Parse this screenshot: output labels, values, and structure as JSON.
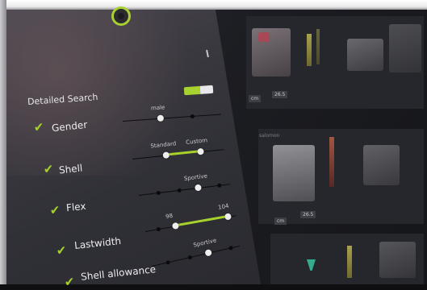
{
  "panel": {
    "title": "Detailed Search",
    "toggle_on": true,
    "filters": [
      {
        "id": "gender",
        "label": "Gender",
        "checked": true,
        "labels": [
          "male"
        ]
      },
      {
        "id": "shell",
        "label": "Shell",
        "checked": true,
        "labels": [
          "Standard",
          "Custom"
        ]
      },
      {
        "id": "flex",
        "label": "Flex",
        "checked": true,
        "labels": [
          "Sportive"
        ]
      },
      {
        "id": "lastwidth",
        "label": "Lastwidth",
        "checked": true,
        "labels": [
          "98",
          "104"
        ]
      },
      {
        "id": "shell_allowance",
        "label": "Shell allowance",
        "checked": true,
        "labels": [
          "Sportive"
        ]
      }
    ]
  },
  "results": {
    "items": [
      {
        "size_prefix": "cm",
        "size": "26.5"
      },
      {
        "size_prefix": "cm",
        "size": "26.5"
      }
    ],
    "misc": [
      "salomon"
    ]
  },
  "colors": {
    "accent": "#a9d12e",
    "panel": "#3a383f",
    "background": "#1c1d22"
  }
}
